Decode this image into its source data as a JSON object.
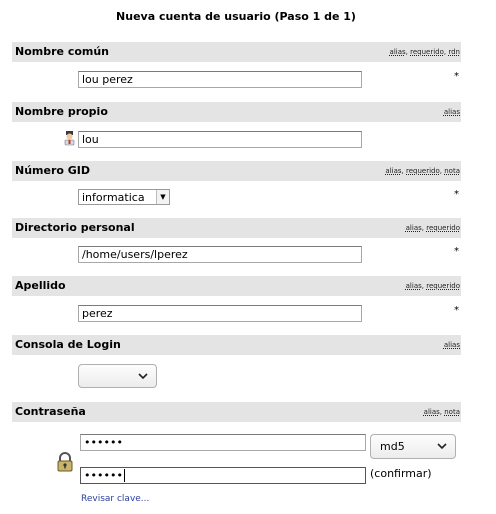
{
  "title": "Nueva cuenta de usuario (Paso 1 de 1)",
  "required_mark": "*",
  "sections": {
    "cn": {
      "label": "Nombre común",
      "meta": [
        "alias",
        "requerido",
        "rdn"
      ],
      "value": "lou perez"
    },
    "given": {
      "label": "Nombre propio",
      "meta": [
        "alias"
      ],
      "value": "lou"
    },
    "gid": {
      "label": "Número GID",
      "meta": [
        "alias",
        "requerido",
        "nota"
      ],
      "value": "informatica"
    },
    "home": {
      "label": "Directorio personal",
      "meta": [
        "alias",
        "requerido"
      ],
      "value": "/home/users/lperez"
    },
    "surname": {
      "label": "Apellido",
      "meta": [
        "alias",
        "requerido"
      ],
      "value": "perez"
    },
    "shell": {
      "label": "Consola de Login",
      "meta": [
        "alias"
      ],
      "value": ""
    },
    "password": {
      "label": "Contraseña",
      "meta": [
        "alias",
        "nota"
      ],
      "value": "••••••",
      "confirm_value": "••••••",
      "hash": "md5",
      "confirm_label": "(confirmar)",
      "check_link": "Revisar clave..."
    }
  },
  "icons": {
    "given": "user-avatar-icon",
    "password": "padlock-icon"
  }
}
